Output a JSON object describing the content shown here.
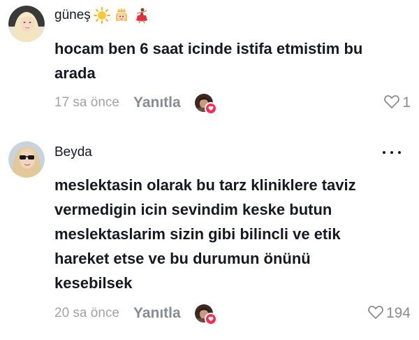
{
  "comments": [
    {
      "username": "güneş",
      "username_emojis": [
        "sun-icon",
        "princess-icon",
        "dancer-icon"
      ],
      "text_lines": [
        "hocam ben 6 saat icinde istifa etmistim bu",
        "arada"
      ],
      "timestamp": "17 sa önce",
      "reply_label": "Yanıtla",
      "like_count": "1",
      "liked_by_creator": true
    },
    {
      "username": "Beyda",
      "text_lines": [
        "meslektasin olarak bu tarz kliniklere taviz",
        "vermedigin icin sevindim keske butun",
        "meslektaslarim sizin gibi bilincli ve etik",
        "hareket etse ve bu durumun önünü",
        "kesebilsek"
      ],
      "timestamp": "20 sa önce",
      "reply_label": "Yanıtla",
      "like_count": "194",
      "liked_by_creator": true
    }
  ],
  "colors": {
    "text": "#161823",
    "secondary": "#8a8b91",
    "timestamp": "#a1a2a7",
    "accent": "#fe2c55"
  }
}
